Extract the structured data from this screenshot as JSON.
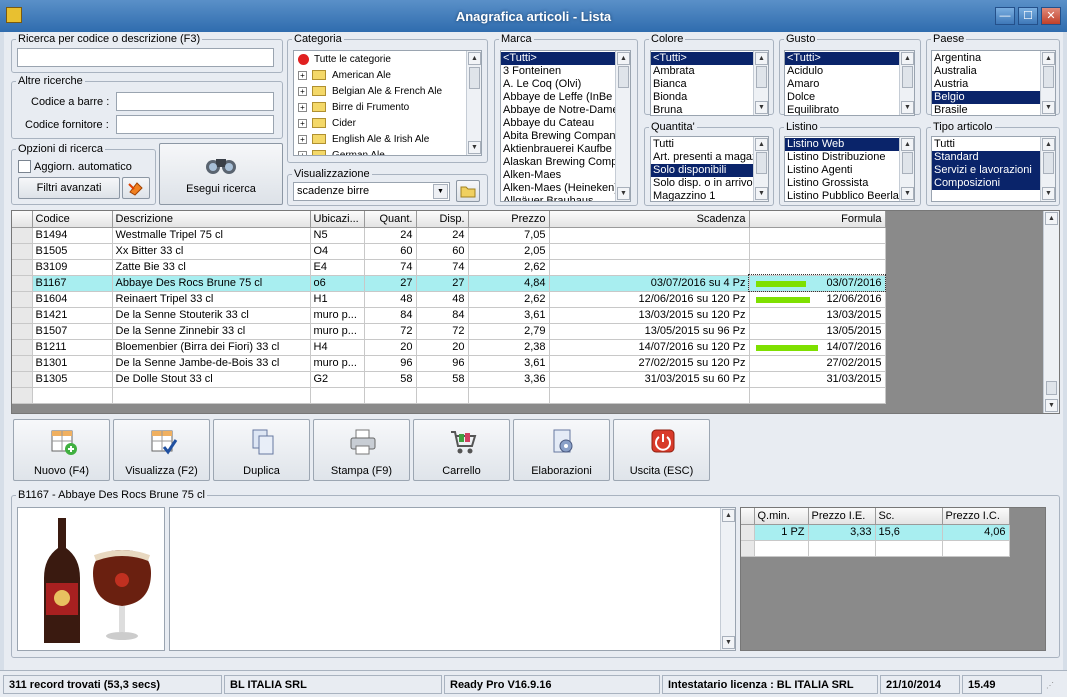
{
  "window": {
    "title": "Anagrafica articoli  - Lista",
    "min": "—",
    "max": "☐",
    "close": "✕"
  },
  "search": {
    "legend": "Ricerca per codice o descrizione (F3)",
    "value": ""
  },
  "altre": {
    "legend": "Altre ricerche",
    "barcode_label": "Codice a barre :",
    "supplier_label": "Codice fornitore :"
  },
  "opzioni": {
    "legend": "Opzioni di ricerca",
    "auto_label": "Aggiorn. automatico",
    "filtri_label": "Filtri avanzati",
    "esegui_label": "Esegui ricerca"
  },
  "categoria": {
    "legend": "Categoria",
    "root": "Tutte le categorie",
    "items": [
      "American Ale",
      "Belgian Ale & French Ale",
      "Birre di Frumento",
      "Cider",
      "English Ale & Irish Ale",
      "German Ale"
    ]
  },
  "visualizzazione": {
    "legend": "Visualizzazione",
    "value": "scadenze birre"
  },
  "marca": {
    "legend": "Marca",
    "items": [
      "<Tutti>",
      "3 Fonteinen",
      "A. Le Coq (Olvi)",
      "Abbaye de Leffe (InBe",
      "Abbaye de Notre-Dame",
      "Abbaye du Cateau",
      "Abita Brewing Compan",
      "Aktienbrauerei Kaufbe",
      "Alaskan Brewing Comp",
      "Alken-Maes",
      "Alken-Maes (Heineken)",
      "Allgäuer Brauhaus"
    ]
  },
  "colore": {
    "legend": "Colore",
    "items": [
      "<Tutti>",
      "Ambrata",
      "Bianca",
      "Bionda",
      "Bruna"
    ]
  },
  "quantita": {
    "legend": "Quantita'",
    "items": [
      "Tutti",
      "Art. presenti a magaz",
      "Solo disponibili",
      "Solo disp. o in arrivo",
      "Magazzino 1"
    ]
  },
  "gusto": {
    "legend": "Gusto",
    "items": [
      "<Tutti>",
      "Acidulo",
      "Amaro",
      "Dolce",
      "Equilibrato"
    ]
  },
  "listino": {
    "legend": "Listino",
    "items": [
      "Listino Web",
      "Listino Distribuzione",
      "Listino Agenti",
      "Listino Grossista",
      "Listino Pubblico Beerland"
    ]
  },
  "paese": {
    "legend": "Paese",
    "items": [
      "Argentina",
      "Australia",
      "Austria",
      "Belgio",
      "Brasile"
    ]
  },
  "tipo": {
    "legend": "Tipo articolo",
    "items": [
      "Tutti",
      "Standard",
      "Servizi e lavorazioni",
      "Composizioni"
    ]
  },
  "table": {
    "headers": [
      "Codice",
      "Descrizione",
      "Ubicazi...",
      "Quant.",
      "Disp.",
      "Prezzo",
      "Scadenza",
      "Formula"
    ],
    "rows": [
      [
        "B1494",
        "Westmalle Tripel 75 cl",
        "N5",
        "24",
        "24",
        "7,05",
        "",
        ""
      ],
      [
        "B1505",
        "Xx Bitter 33 cl",
        "O4",
        "60",
        "60",
        "2,05",
        "",
        ""
      ],
      [
        "B3109",
        "Zatte Bie 33 cl",
        "E4",
        "74",
        "74",
        "2,62",
        "",
        ""
      ],
      [
        "B1167",
        "Abbaye Des Rocs Brune 75 cl",
        "o6",
        "27",
        "27",
        "4,84",
        "03/07/2016 su 4 Pz",
        "03/07/2016"
      ],
      [
        "B1604",
        "Reinaert Tripel 33 cl",
        "H1",
        "48",
        "48",
        "2,62",
        "12/06/2016 su 120 Pz",
        "12/06/2016"
      ],
      [
        "B1421",
        "De la Senne Stouterik 33 cl",
        "muro p...",
        "84",
        "84",
        "3,61",
        "13/03/2015 su 120 Pz",
        "13/03/2015"
      ],
      [
        "B1507",
        "De la Senne Zinnebir 33 cl",
        "muro p...",
        "72",
        "72",
        "2,79",
        "13/05/2015 su 96 Pz",
        "13/05/2015"
      ],
      [
        "B1211",
        "Bloemenbier (Birra dei Fiori) 33 cl",
        "H4",
        "20",
        "20",
        "2,38",
        "14/07/2016 su 120 Pz",
        "14/07/2016"
      ],
      [
        "B1301",
        "De la Senne Jambe-de-Bois 33 cl",
        "muro p...",
        "96",
        "96",
        "3,61",
        "27/02/2015 su 120 Pz",
        "27/02/2015"
      ],
      [
        "B1305",
        "De Dolle Stout 33 cl",
        "G2",
        "58",
        "58",
        "3,36",
        "31/03/2015 su 60 Pz",
        "31/03/2015"
      ]
    ]
  },
  "toolbar": {
    "nuovo": "Nuovo (F4)",
    "visualizza": "Visualizza (F2)",
    "duplica": "Duplica",
    "stampa": "Stampa (F9)",
    "carrello": "Carrello",
    "elaborazioni": "Elaborazioni",
    "uscita": "Uscita (ESC)"
  },
  "detail": {
    "legend": "B1167 - Abbaye Des Rocs Brune 75 cl",
    "price_headers": [
      "Q.min.",
      "Prezzo I.E.",
      "Sc.",
      "Prezzo I.C."
    ],
    "price_row": [
      "1 PZ",
      "3,33",
      "15,6",
      "4,06"
    ]
  },
  "status": {
    "records": "311 record trovati (53,3 secs)",
    "company": "BL ITALIA SRL",
    "version": "Ready Pro V16.9.16",
    "license": "Intestatario licenza : BL ITALIA SRL",
    "date": "21/10/2014",
    "time": "15.49"
  },
  "colors": {
    "accent": "#0a246a",
    "highlight_row": "#a8eef0",
    "formula_bar": "#7ee000"
  }
}
